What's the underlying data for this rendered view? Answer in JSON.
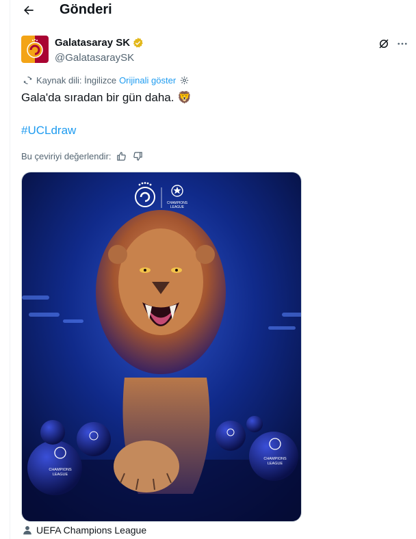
{
  "header": {
    "title": "Gönderi",
    "back_icon": "arrow-left-icon"
  },
  "author": {
    "display_name": "Galatasaray SK",
    "handle": "@GalatasaraySK",
    "verified_badge_color": "#e2b719",
    "avatar_colors": [
      "#f3a416",
      "#a90432"
    ]
  },
  "translation": {
    "source_label": "Kaynak dili: İngilizce",
    "show_original": "Orijinali göster"
  },
  "tweet": {
    "text": "Gala'da sıradan bir gün daha. 🦁",
    "hashtag": "#UCLdraw"
  },
  "rating": {
    "label": "Bu çeviriyi değerlendir:"
  },
  "media": {
    "alt": "Lion with UEFA Champions League balls",
    "poster_text_line1": "CHAMPIONS",
    "poster_text_line2": "LEAGUE",
    "ball_text_line1": "CHAMPIONS",
    "ball_text_line2": "LEAGUE"
  },
  "tagged": {
    "label": "UEFA Champions League"
  },
  "colors": {
    "accent": "#1d9bf0",
    "secondary_text": "#536471"
  }
}
